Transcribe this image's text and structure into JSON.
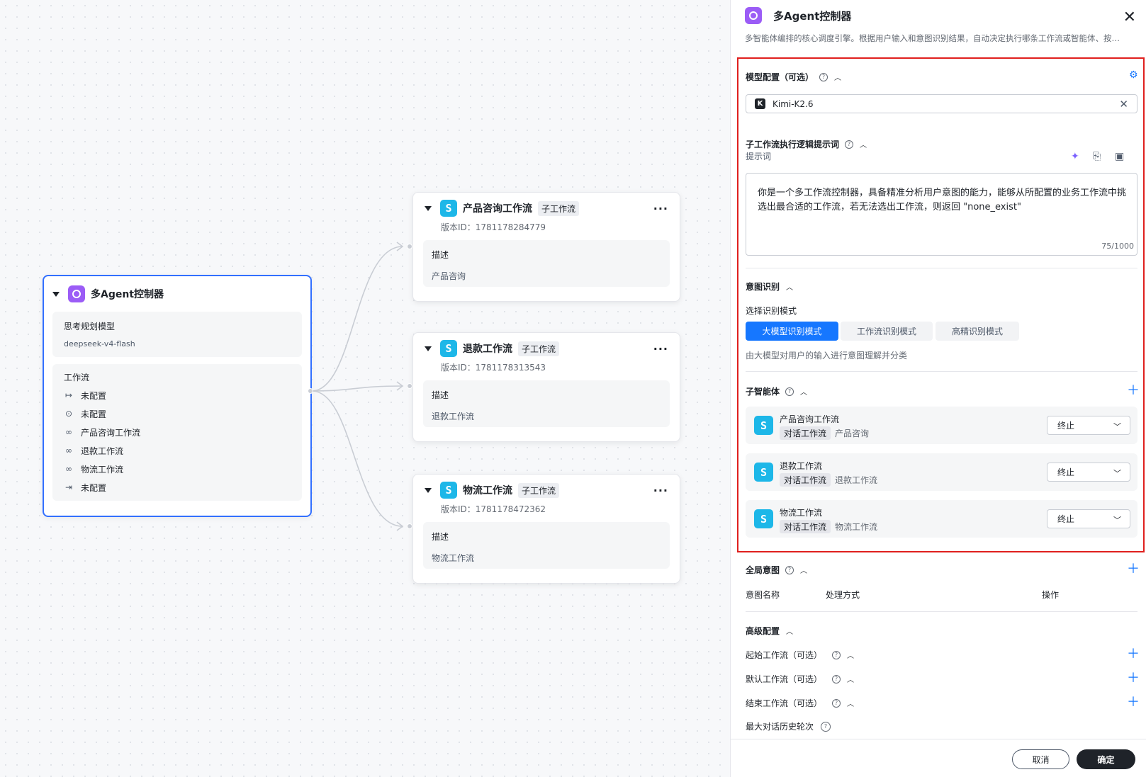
{
  "controller_node": {
    "title": "多Agent控制器",
    "model_label": "思考规划模型",
    "model_value": "deepseek-v4-flash",
    "workflow_label": "工作流",
    "workflow_items": [
      {
        "icon": "arrow-right-bar-icon",
        "label": "未配置"
      },
      {
        "icon": "location-pin-icon",
        "label": "未配置"
      },
      {
        "icon": "workflow-link-icon",
        "label": "产品咨询工作流"
      },
      {
        "icon": "workflow-link-icon",
        "label": "退款工作流"
      },
      {
        "icon": "workflow-link-icon",
        "label": "物流工作流"
      },
      {
        "icon": "arrow-to-end-icon",
        "label": "未配置"
      }
    ]
  },
  "sub_nodes": [
    {
      "title": "产品咨询工作流",
      "tag": "子工作流",
      "version": "版本ID：1781178284779",
      "desc_label": "描述",
      "desc": "产品咨询"
    },
    {
      "title": "退款工作流",
      "tag": "子工作流",
      "version": "版本ID：1781178313543",
      "desc_label": "描述",
      "desc": "退款工作流"
    },
    {
      "title": "物流工作流",
      "tag": "子工作流",
      "version": "版本ID：1781178472362",
      "desc_label": "描述",
      "desc": "物流工作流"
    }
  ],
  "panel": {
    "title": "多Agent控制器",
    "subtitle": "多智能体编排的核心调度引擎。根据用户输入和意图识别结果，自动决定执行哪条工作流或智能体、按…",
    "model_section": {
      "title": "模型配置（可选）",
      "model": "Kimi-K2.6"
    },
    "prompt_section": {
      "title": "子工作流执行逻辑提示词",
      "label": "提示词",
      "text": "你是一个多工作流控制器，具备精准分析用户意图的能力，能够从所配置的业务工作流中挑选出最合适的工作流，若无法选出工作流，则返回 \"none_exist\"",
      "count": "75/1000"
    },
    "intent_section": {
      "title": "意图识别",
      "mode_label": "选择识别模式",
      "modes": [
        "大模型识别模式",
        "工作流识别模式",
        "高精识别模式"
      ],
      "active_mode": "大模型识别模式",
      "hint": "由大模型对用户的输入进行意图理解并分类"
    },
    "sub_agents": {
      "title": "子智能体",
      "items": [
        {
          "name": "产品咨询工作流",
          "tag": "对话工作流",
          "desc": "产品咨询",
          "action": "终止"
        },
        {
          "name": "退款工作流",
          "tag": "对话工作流",
          "desc": "退款工作流",
          "action": "终止"
        },
        {
          "name": "物流工作流",
          "tag": "对话工作流",
          "desc": "物流工作流",
          "action": "终止"
        }
      ]
    },
    "global_intent": {
      "title": "全局意图",
      "columns": [
        "意图名称",
        "处理方式",
        "操作"
      ]
    },
    "advanced": {
      "title": "高级配置",
      "start": "起始工作流（可选）",
      "default": "默认工作流（可选）",
      "end": "结束工作流（可选）",
      "history": "最大对话历史轮次"
    },
    "footer": {
      "cancel": "取消",
      "confirm": "确定"
    }
  },
  "colors": {
    "accent": "#1677ff",
    "highlight_box": "#e0201e",
    "node_border": "#3370ff",
    "agent_icon": "#9b5cf6",
    "workflow_icon": "#1db7e8"
  }
}
